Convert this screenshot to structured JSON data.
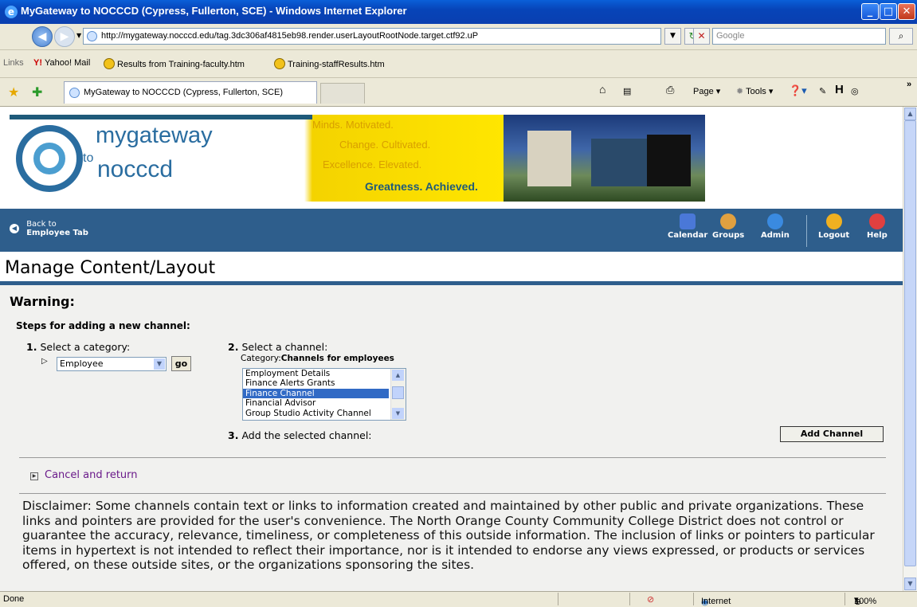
{
  "window": {
    "title": "MyGateway to NOCCCD (Cypress, Fullerton, SCE) - Windows Internet Explorer",
    "min": "_",
    "max": "□",
    "close": "✕"
  },
  "address": {
    "url": "http://mygateway.nocccd.edu/tag.3dc306af4815eb98.render.userLayoutRootNode.target.ctf92.uP",
    "search_placeholder": "Google"
  },
  "links_bar": {
    "label": "Links",
    "items": [
      "Yahoo! Mail",
      "Results from Training-faculty.htm",
      "Training-staffResults.htm"
    ]
  },
  "tabs": {
    "active": "MyGateway to NOCCCD (Cypress, Fullerton, SCE)"
  },
  "command_bar": {
    "page": "Page",
    "tools": "Tools",
    "more": "»"
  },
  "banner": {
    "logo_line1": "mygateway",
    "logo_to": "to",
    "logo_line2": "nocccd",
    "slogan1": "Minds. Motivated.",
    "slogan2": "Change. Cultivated.",
    "slogan3": "Excellence. Elevated.",
    "slogan4": "Greatness. Achieved."
  },
  "nav": {
    "back_line1": "Back to",
    "back_line2": "Employee Tab",
    "calendar": "Calendar",
    "groups": "Groups",
    "admin": "Admin",
    "logout": "Logout",
    "help": "Help"
  },
  "page": {
    "title": "Manage Content/Layout",
    "warning": "Warning:",
    "steps_heading": "Steps for adding a new channel:",
    "step1_num": "1.",
    "step1_label": "Select a category:",
    "category_value": "Employee",
    "go": "go",
    "step2_num": "2.",
    "step2_label": "Select a channel:",
    "category_prefix": "Category:",
    "category_name": "Channels for employees",
    "channels": [
      "Employment Details",
      "Finance Alerts Grants",
      "Finance Channel",
      "Financial Advisor",
      "Group Studio Activity Channel"
    ],
    "selected_channel": "Finance Channel",
    "step3_num": "3.",
    "step3_label": "Add the selected channel:",
    "add_button": "Add Channel",
    "cancel": "Cancel and return",
    "disclaimer": "Disclaimer: Some channels contain text or links to information created and maintained by other public and private organizations. These links and pointers are provided for the user's convenience. The North Orange County Community College District does not control or guarantee the accuracy, relevance, timeliness, or completeness of this outside information. The inclusion of links or pointers to particular items in hypertext is not intended to reflect their importance, nor is it intended to endorse any views expressed, or products or services offered, on these outside sites, or the organizations sponsoring the sites."
  },
  "status": {
    "left": "Done",
    "zone": "Internet",
    "zoom": "100%"
  },
  "colors": {
    "nav_band": "#2e5e8c",
    "selection": "#316ac5",
    "banner_yellow": "#ffe600"
  }
}
